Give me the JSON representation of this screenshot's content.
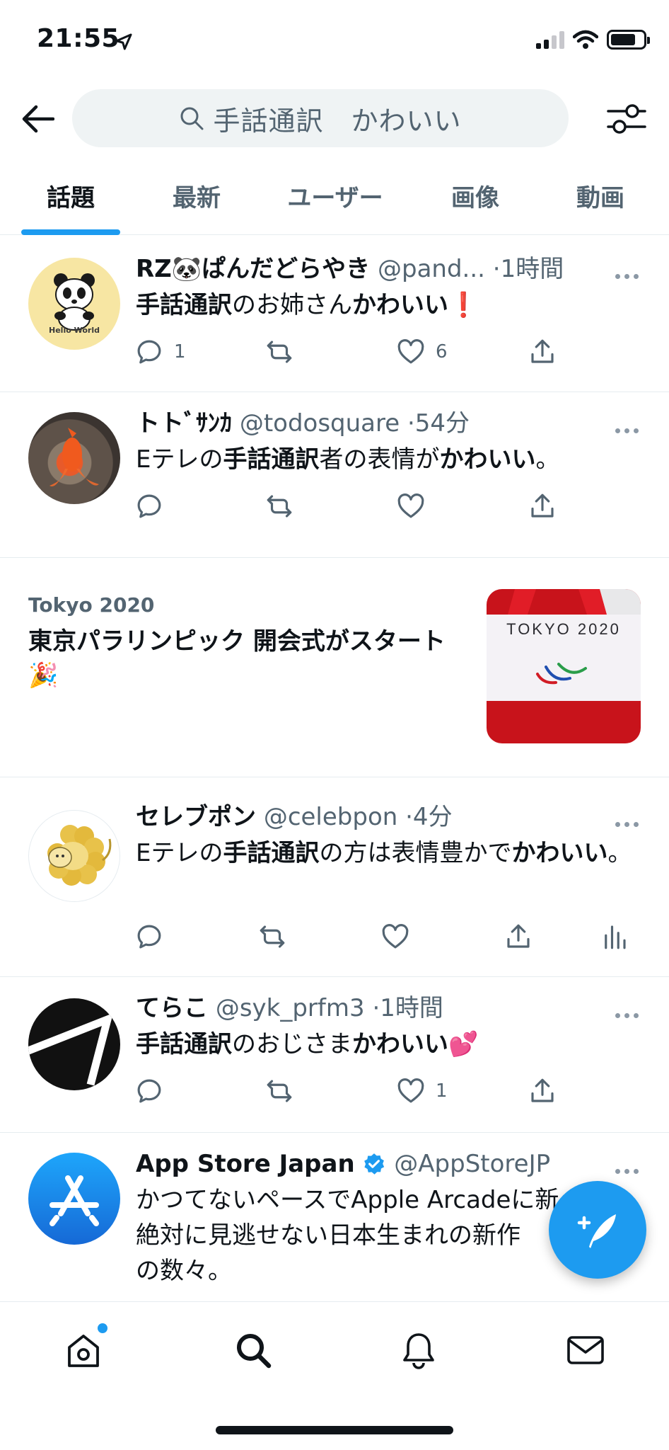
{
  "status_bar": {
    "time": "21:55"
  },
  "search": {
    "query": "手話通訳　かわいい"
  },
  "tabs": [
    {
      "label": "話題",
      "active": true
    },
    {
      "label": "最新",
      "active": false
    },
    {
      "label": "ユーザー",
      "active": false
    },
    {
      "label": "画像",
      "active": false
    },
    {
      "label": "動画",
      "active": false
    }
  ],
  "tweets": [
    {
      "name": "RZ🐼ぱんだどらやき",
      "handle": "@pand...",
      "time": "·1時間",
      "text_parts": [
        {
          "text": "手話通訳",
          "bold": true
        },
        {
          "text": "のお姉さん",
          "bold": false
        },
        {
          "text": "かわいい",
          "bold": true
        },
        {
          "text": "❗",
          "bold": false
        }
      ],
      "avatar": "panda-hello-world",
      "avatar_text": "Hello World",
      "reply_count": "1",
      "retweet_count": "",
      "like_count": "6"
    },
    {
      "name": "トトﾞｻﾝｶ",
      "handle": "@todosquare",
      "time": "·54分",
      "text_parts": [
        {
          "text": "Eテレの",
          "bold": false
        },
        {
          "text": "手話通訳",
          "bold": true
        },
        {
          "text": "者の表情が",
          "bold": false
        },
        {
          "text": "かわいい",
          "bold": true
        },
        {
          "text": "。",
          "bold": false
        }
      ],
      "avatar": "goldfish",
      "reply_count": "",
      "retweet_count": "",
      "like_count": ""
    },
    {
      "name": "セレブポン",
      "handle": "@celebpon",
      "time": "·4分",
      "text_parts": [
        {
          "text": "Eテレの",
          "bold": false
        },
        {
          "text": "手話通訳",
          "bold": true
        },
        {
          "text": "の方は表情豊かで",
          "bold": false
        },
        {
          "text": "かわいい",
          "bold": true
        },
        {
          "text": "。",
          "bold": false
        }
      ],
      "avatar": "golden-lion",
      "reply_count": "",
      "retweet_count": "",
      "like_count": ""
    },
    {
      "name": "てらこ",
      "handle": "@syk_prfm3",
      "time": "·1時間",
      "text_parts": [
        {
          "text": "手話通訳",
          "bold": true
        },
        {
          "text": "のおじさま",
          "bold": false
        },
        {
          "text": "かわいい",
          "bold": true
        },
        {
          "text": "💕",
          "bold": false
        }
      ],
      "avatar": "dark-abstract",
      "reply_count": "",
      "retweet_count": "",
      "like_count": "1"
    },
    {
      "name": "App Store Japan",
      "handle": "@AppStoreJP",
      "time": "",
      "verified": true,
      "text_parts": [
        {
          "text": "かつてないペースでApple Arcadeに新",
          "bold": false
        },
        {
          "text": "絶対に見逃せない日本生まれの新作",
          "bold": false
        },
        {
          "text": "の数々。",
          "bold": false
        }
      ],
      "avatar": "app-store"
    }
  ],
  "trend": {
    "category": "Tokyo 2020",
    "title": "東京パラリンピック 開会式がスタート🎉",
    "image_text": "TOKYO 2020"
  },
  "nav": [
    "home-icon",
    "search-icon",
    "bell-icon",
    "mail-icon"
  ],
  "colors": {
    "accent": "#1d9bf0",
    "text": "#0f1419",
    "muted": "#536471",
    "divider": "#e6ecf0"
  }
}
